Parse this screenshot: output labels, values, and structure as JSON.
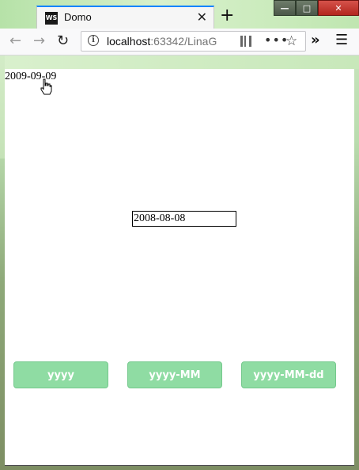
{
  "browser": {
    "tab_favicon": "WS",
    "tab_title": "Domo",
    "tab_close": "✕",
    "new_tab": "+",
    "url_host": "localhost",
    "url_rest": ":63342/LinaG",
    "window_controls": {
      "minimize": "—",
      "maximize": "□",
      "close": "✕"
    },
    "icons": [
      "back-icon",
      "forward-icon",
      "reload-icon",
      "info-icon",
      "qr-code-icon",
      "more-icon",
      "bookmark-star-icon",
      "overflow-icon",
      "menu-icon"
    ]
  },
  "page": {
    "date_display": "2009-09-09",
    "date_input_value": "2008-08-08",
    "buttons": {
      "yyyy": "yyyy",
      "yyyy_mm": "yyyy-MM",
      "yyyy_mm_dd": "yyyy-MM-dd"
    }
  },
  "colors": {
    "button_bg": "#8fdca3",
    "button_text": "#ffffff",
    "accent_tab": "#0a84ff"
  }
}
